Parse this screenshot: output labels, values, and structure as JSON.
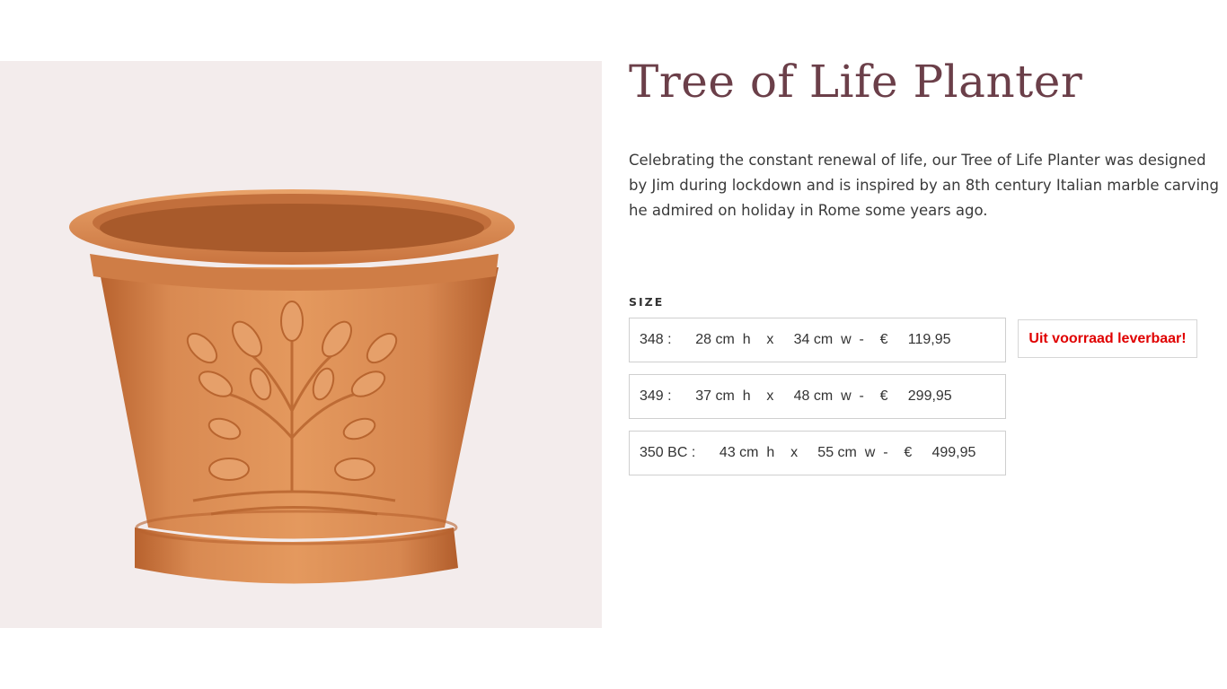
{
  "product": {
    "title": "Tree of Life Planter",
    "description": "Celebrating the constant renewal of life, our Tree of Life Planter was designed by Jim during lockdown and is inspired by an 8th century Italian marble carving he admired on holiday in Rome some years ago.",
    "image_subject": "terracotta-tree-of-life-planter"
  },
  "size": {
    "label": "SIZE",
    "options": [
      {
        "text": "348 :      28 cm  h    x     34 cm  w  -    €     119,95"
      },
      {
        "text": "349 :      37 cm  h    x     48 cm  w  -    €     299,95"
      },
      {
        "text": "350 BC :      43 cm  h    x     55 cm  w  -    €     499,95"
      }
    ]
  },
  "stock": {
    "text": "Uit voorraad leverbaar!",
    "color": "#e00000"
  },
  "colors": {
    "title": "#6b3f49",
    "image_background": "#f3ecec",
    "terracotta": "#d98a52"
  }
}
